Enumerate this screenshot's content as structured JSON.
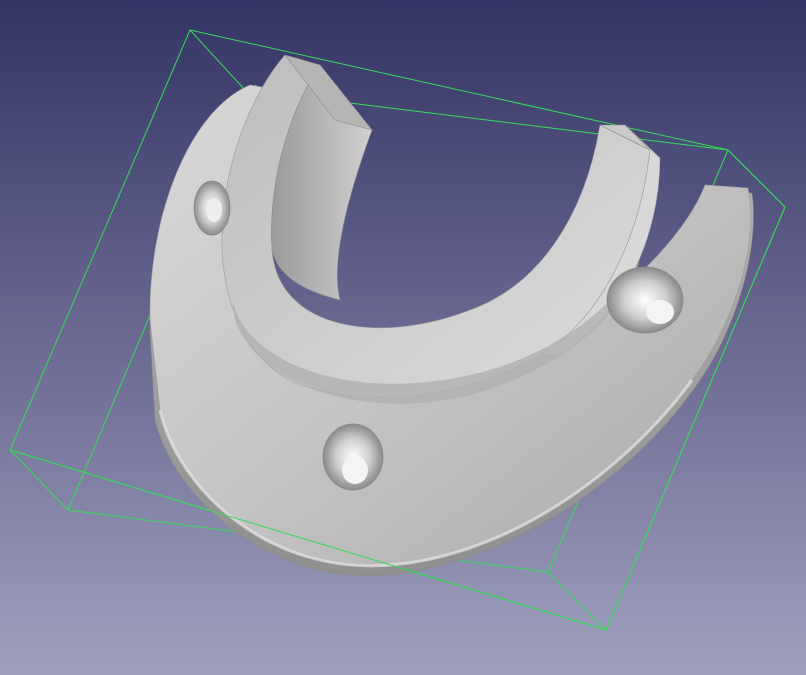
{
  "viewport": {
    "background_top_color": "#343466",
    "background_bottom_color": "#9f9fbd",
    "bounding_box_color": "#33dd55",
    "model_color": "#c8c8c8"
  },
  "model": {
    "name": "",
    "visible_holes": 3
  }
}
